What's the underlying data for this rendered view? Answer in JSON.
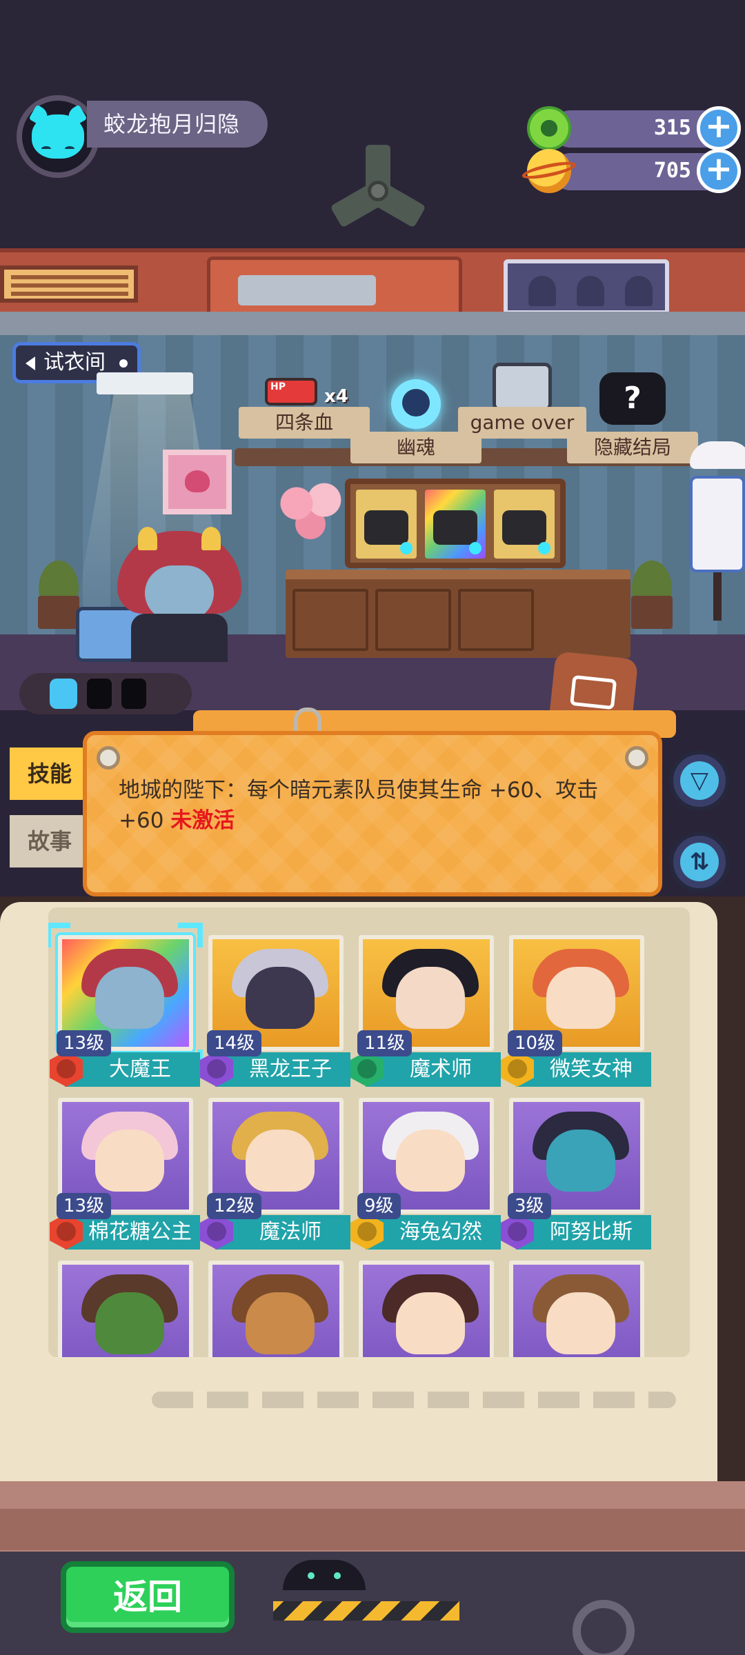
{
  "player": {
    "name": "蛟龙抱月归隐",
    "avatar_icon": "cat-avatar-icon"
  },
  "resources": [
    {
      "id": "green-coin",
      "value": "315",
      "icon": "green-coin-icon",
      "color": "#7fd641"
    },
    {
      "id": "planet-gem",
      "value": "705",
      "icon": "planet-icon",
      "color": "#ffd24a"
    }
  ],
  "scene": {
    "back_sign": "试衣间",
    "endings": [
      {
        "label": "四条血",
        "icon": "hp-battery-icon",
        "badge_hp": "HP",
        "badge_count": "x4"
      },
      {
        "label": "幽魂",
        "icon": "ghost-skull-icon"
      },
      {
        "label": "game over",
        "icon": "gravestone-tv-icon"
      },
      {
        "label": "隐藏结局",
        "icon": "mystery-box-icon",
        "mark": "?"
      }
    ],
    "energy_icon": "energy-bolt-icon"
  },
  "tabs": {
    "skill": "技能",
    "story": "故事"
  },
  "skill_panel": {
    "description": "地城的陛下：每个暗元素队员使其生命 +60、攻击 +60",
    "status": "未激活",
    "status_color": "#e6181c"
  },
  "side_buttons": {
    "filter_icon": "filter-icon",
    "swap_icon": "swap-arrows-icon"
  },
  "characters": [
    {
      "level": "13级",
      "name": "大魔王",
      "frame": "rainbow",
      "element_color": "#e8442f",
      "hair": "#b43948",
      "skin": "#8db3ce",
      "selected": true
    },
    {
      "level": "14级",
      "name": "黑龙王子",
      "frame": "gold",
      "element_color": "#8b4fd6",
      "hair": "#c9c6d8",
      "skin": "#3d3750",
      "selected": false
    },
    {
      "level": "11级",
      "name": "魔术师",
      "frame": "gold",
      "element_color": "#26b06b",
      "hair": "#1e1d28",
      "skin": "#f3d9c6",
      "selected": false
    },
    {
      "level": "10级",
      "name": "微笑女神",
      "frame": "gold",
      "element_color": "#f2b31e",
      "hair": "#e2673c",
      "skin": "#f8dcc4",
      "selected": false
    },
    {
      "level": "13级",
      "name": "棉花糖公主",
      "frame": "purple",
      "element_color": "#e8442f",
      "hair": "#f3c7d8",
      "skin": "#f8dcc4",
      "selected": false
    },
    {
      "level": "12级",
      "name": "魔法师",
      "frame": "purple",
      "element_color": "#8b4fd6",
      "hair": "#e1b04a",
      "skin": "#f8dcc4",
      "selected": false
    },
    {
      "level": "9级",
      "name": "海兔幻然",
      "frame": "purple",
      "element_color": "#f2b31e",
      "hair": "#f1eef2",
      "skin": "#f8dcc4",
      "selected": false
    },
    {
      "level": "3级",
      "name": "阿努比斯",
      "frame": "purple",
      "element_color": "#8b4fd6",
      "hair": "#2b2a40",
      "skin": "#3aa3b8",
      "selected": false
    },
    {
      "level": "",
      "name": "",
      "frame": "purple",
      "element_color": "",
      "hair": "#5a3a2a",
      "skin": "#4f8a3c",
      "selected": false
    },
    {
      "level": "",
      "name": "",
      "frame": "purple",
      "element_color": "",
      "hair": "#7a4a2a",
      "skin": "#c98a4a",
      "selected": false
    },
    {
      "level": "",
      "name": "",
      "frame": "purple",
      "element_color": "",
      "hair": "#4b2a28",
      "skin": "#f8dcc4",
      "selected": false
    },
    {
      "level": "",
      "name": "",
      "frame": "purple",
      "element_color": "",
      "hair": "#8a5a36",
      "skin": "#f8dcc4",
      "selected": false
    }
  ],
  "footer": {
    "return_label": "返回"
  }
}
